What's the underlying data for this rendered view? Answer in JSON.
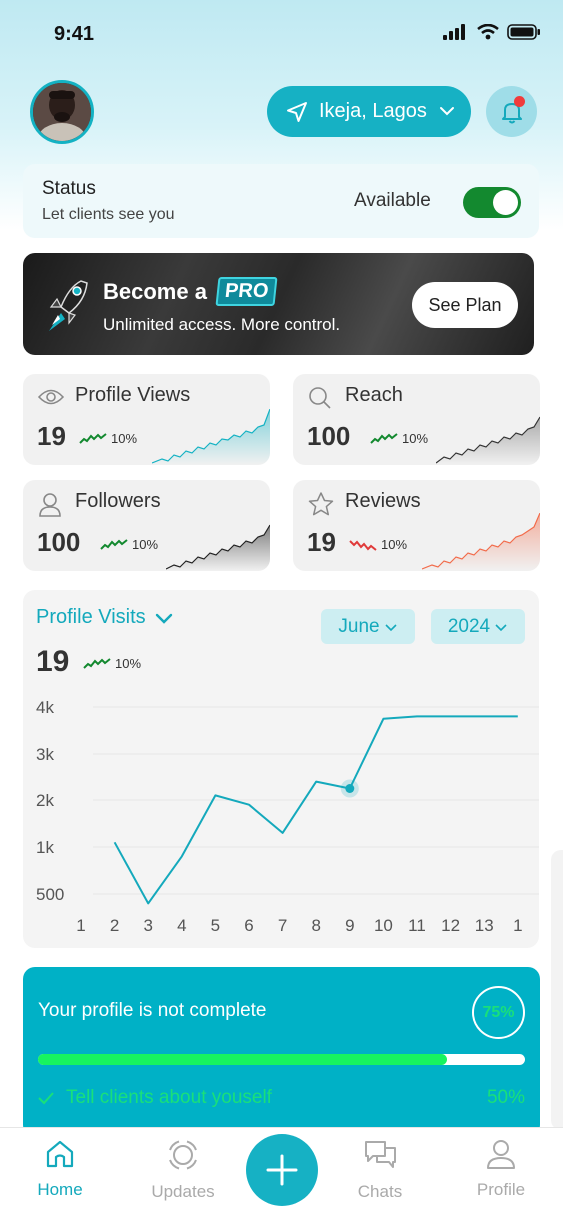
{
  "status_bar": {
    "time": "9:41"
  },
  "header": {
    "location": "Ikeja, Lagos"
  },
  "status": {
    "title": "Status",
    "subtitle": "Let clients see you",
    "state_label": "Available",
    "toggle_on": true
  },
  "pro_banner": {
    "title_prefix": "Become a",
    "badge": "PRO",
    "subtitle": "Unlimited access. More control.",
    "button": "See Plan"
  },
  "stats": [
    {
      "label": "Profile Views",
      "value": "19",
      "trend": "10%",
      "direction": "up",
      "icon": "eye-icon",
      "trend_color": "#13892f",
      "spark_color": "#14b2c3"
    },
    {
      "label": "Reach",
      "value": "100",
      "trend": "10%",
      "direction": "up",
      "icon": "search-icon",
      "trend_color": "#13892f",
      "spark_color": "#333333"
    },
    {
      "label": "Followers",
      "value": "100",
      "trend": "10%",
      "direction": "up",
      "icon": "user-icon",
      "trend_color": "#13892f",
      "spark_color": "#222222"
    },
    {
      "label": "Reviews",
      "value": "19",
      "trend": "10%",
      "direction": "down",
      "icon": "star-icon",
      "trend_color": "#e03a3a",
      "spark_color": "#f26b4a"
    }
  ],
  "visits": {
    "title": "Profile Visits",
    "month": "June",
    "year": "2024",
    "value": "19",
    "trend": "10%"
  },
  "chart_data": {
    "type": "line",
    "title": "Profile Visits",
    "y_ticks": [
      "4k",
      "3k",
      "2k",
      "1k",
      "500"
    ],
    "x_ticks": [
      "1",
      "2",
      "3",
      "4",
      "5",
      "6",
      "7",
      "8",
      "9",
      "10",
      "11",
      "12",
      "13",
      "1"
    ],
    "series": [
      {
        "x": [
          2,
          3,
          4,
          5,
          6,
          7,
          8,
          9,
          10,
          11,
          12,
          13,
          14
        ],
        "y": [
          1100,
          400,
          900,
          2100,
          1900,
          1300,
          2400,
          2250,
          3750,
          3800,
          3800,
          3800,
          3800
        ]
      }
    ],
    "highlight_index": 7,
    "line_color": "#14a9bc",
    "ylim": [
      500,
      4000
    ]
  },
  "profile_completion": {
    "title": "Your profile is not complete",
    "percent_label": "75%",
    "percent": 0.84,
    "task": "Tell clients about youself",
    "task_percent": "50%"
  },
  "nav": {
    "home": "Home",
    "updates": "Updates",
    "chats": "Chats",
    "profile": "Profile"
  },
  "colors": {
    "accent": "#16b1c4",
    "success": "#13892f",
    "danger": "#e03a3a"
  }
}
